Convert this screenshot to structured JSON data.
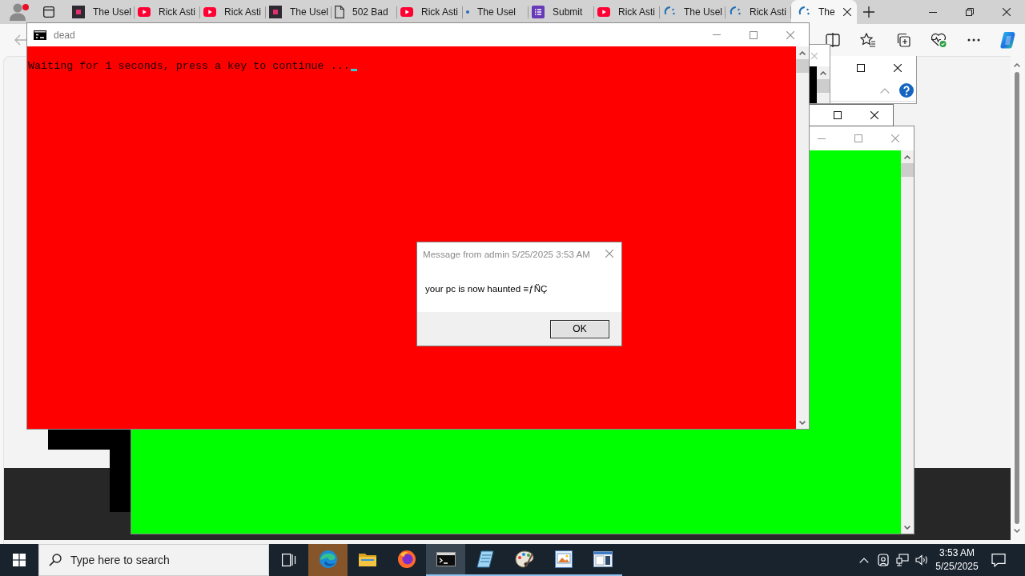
{
  "browser": {
    "tabs": [
      {
        "title": "The Usel",
        "kind": "site",
        "selected": false
      },
      {
        "title": "Rick Asti",
        "kind": "video",
        "selected": false
      },
      {
        "title": "Rick Asti",
        "kind": "video",
        "selected": false
      },
      {
        "title": "The Usel",
        "kind": "site",
        "selected": false
      },
      {
        "title": "502 Bad",
        "kind": "page",
        "selected": false
      },
      {
        "title": "Rick Asti",
        "kind": "video",
        "selected": false
      },
      {
        "title": "The Usel",
        "kind": "dot",
        "selected": false
      },
      {
        "title": "Submit",
        "kind": "form",
        "selected": false
      },
      {
        "title": "Rick Asti",
        "kind": "video",
        "selected": false
      },
      {
        "title": "The Usel",
        "kind": "loading",
        "selected": false
      },
      {
        "title": "Rick Asti",
        "kind": "loading",
        "selected": false
      },
      {
        "title": "The",
        "kind": "loading",
        "selected": true
      }
    ]
  },
  "console_window": {
    "title": "dead",
    "output": "Waiting for 1 seconds, press a key to continue ..."
  },
  "message_box": {
    "title": "Message from admin 5/25/2025 3:53 AM",
    "message": "your pc is now haunted ≡ƒÑÇ",
    "button": "OK"
  },
  "taskbar": {
    "search": {
      "placeholder": "Type here to search"
    },
    "apps": [
      {
        "kind": "browser",
        "flashing": true,
        "selected": false,
        "running": false
      },
      {
        "kind": "folder",
        "flashing": false,
        "selected": false,
        "running": false
      },
      {
        "kind": "webbrowser",
        "flashing": false,
        "selected": false,
        "running": false
      },
      {
        "kind": "console",
        "flashing": false,
        "selected": true,
        "running": true
      },
      {
        "kind": "notepad",
        "flashing": false,
        "selected": false,
        "running": true
      },
      {
        "kind": "paint",
        "flashing": false,
        "selected": false,
        "running": true
      },
      {
        "kind": "viewer",
        "flashing": false,
        "selected": false,
        "running": true
      },
      {
        "kind": "window",
        "flashing": false,
        "selected": false,
        "running": true
      }
    ],
    "clock": {
      "time": "3:53 AM",
      "date": "5/25/2025"
    }
  }
}
